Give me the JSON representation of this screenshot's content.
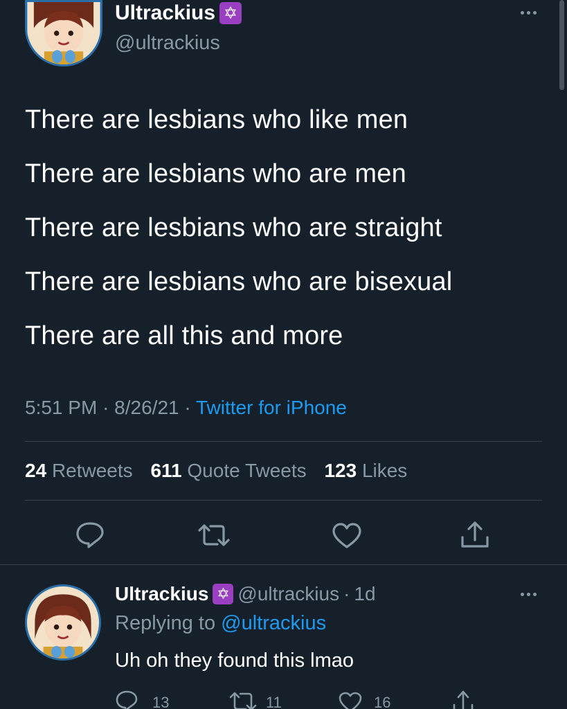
{
  "main_tweet": {
    "display_name": "Ultrackius",
    "badge_glyph": "✡",
    "handle": "@ultrackius",
    "lines": [
      "There are lesbians who like men",
      "There are lesbians who are men",
      "There are lesbians who are straight",
      "There are lesbians who are bisexual",
      "There are all this and more"
    ],
    "time": "5:51 PM",
    "date": "8/26/21",
    "source": "Twitter for iPhone",
    "stats": {
      "retweets_count": "24",
      "retweets_label": "Retweets",
      "quotes_count": "611",
      "quotes_label": "Quote Tweets",
      "likes_count": "123",
      "likes_label": "Likes"
    }
  },
  "reply_tweet": {
    "display_name": "Ultrackius",
    "badge_glyph": "✡",
    "handle": "@ultrackius",
    "age": "1d",
    "replying_prefix": "Replying to",
    "replying_to": "@ultrackius",
    "text": "Uh oh they found this lmao",
    "reply_count": "13",
    "retweet_count": "11",
    "like_count": "16"
  },
  "colors": {
    "background": "#15202b",
    "accent": "#1d9bf0",
    "muted": "#8899a6",
    "badge": "#9b3fc2"
  }
}
